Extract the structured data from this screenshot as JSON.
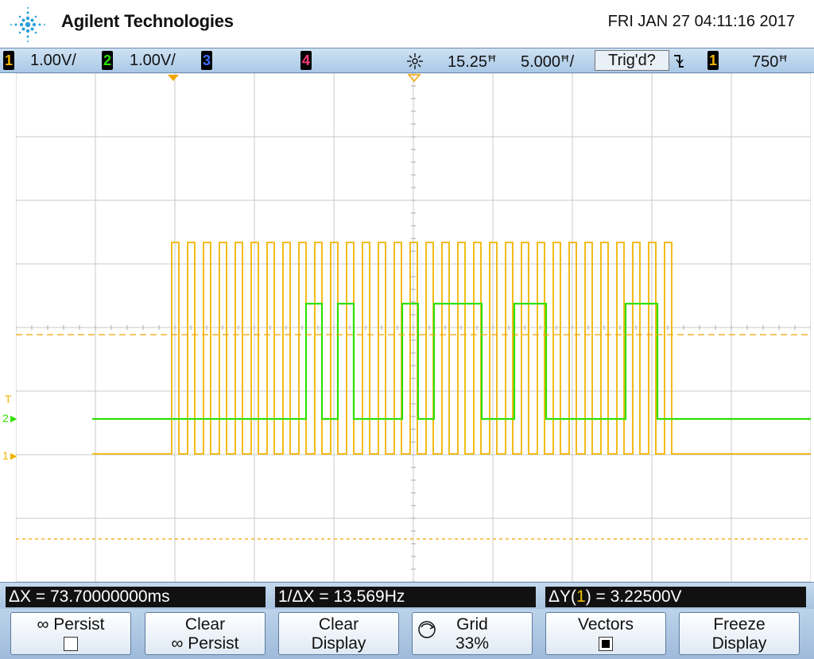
{
  "header": {
    "brand": "Agilent Technologies",
    "datetime": "FRI JAN 27 04:11:16 2017",
    "logo_icon": "agilent-spark-icon"
  },
  "status": {
    "ch1_num": "1",
    "ch1_scale": "1.00V/",
    "ch2_num": "2",
    "ch2_scale": "1.00V/",
    "ch3_num": "3",
    "ch4_num": "4",
    "time_ref_icon": "time-reference-icon",
    "delay": "15.25ꟸ",
    "timebase": "5.000ꟸ/",
    "trigger_state": "Trig'd?",
    "trigger_edge_icon": "falling-edge-icon",
    "trig_source": "1",
    "trig_level": "750ꟸ"
  },
  "colors": {
    "ch1": "#f2b400",
    "ch2": "#2fe000",
    "ch3": "#3d6cff",
    "ch4": "#ff3b7a",
    "grid": "#c8c8c8"
  },
  "markers": {
    "trigger_label": "T",
    "ch2_label": "2",
    "ch1_label": "1"
  },
  "measurements": {
    "delta_x": "ΔX = 73.70000000ms",
    "inv_delta_x": "1/ΔX = 13.569Hz",
    "delta_y_prefix": "ΔY(",
    "delta_y_channel": "1",
    "delta_y_suffix": ") = 3.22500V"
  },
  "softkeys": {
    "persist": "∞ Persist",
    "clear_persist_1": "Clear",
    "clear_persist_2": "∞ Persist",
    "clear_display_1": "Clear",
    "clear_display_2": "Display",
    "grid_label": "Grid",
    "grid_value": "33%",
    "vectors": "Vectors",
    "freeze_1": "Freeze",
    "freeze_2": "Display"
  }
}
